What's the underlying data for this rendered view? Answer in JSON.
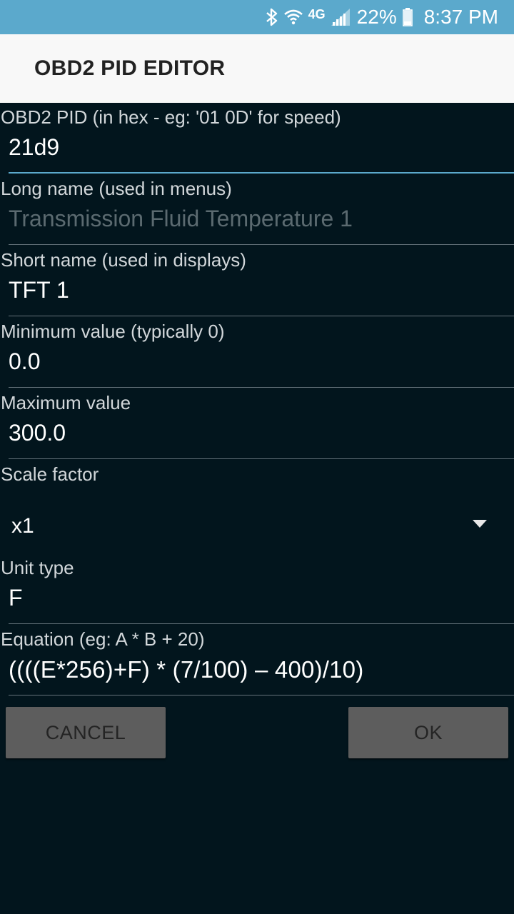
{
  "status_bar": {
    "icons": [
      "bluetooth-icon",
      "wifi-icon",
      "4g-lte-icon",
      "signal-icon",
      "battery-icon"
    ],
    "network_label": "4G",
    "battery_percent": "22%",
    "time": "8:37 PM"
  },
  "app_bar": {
    "title": "OBD2 PID EDITOR"
  },
  "form": {
    "pid": {
      "label": "OBD2 PID (in hex - eg: '01 0D' for speed)",
      "value": "21d9"
    },
    "long_name": {
      "label": "Long name (used in menus)",
      "placeholder": "Transmission Fluid Temperature 1"
    },
    "short_name": {
      "label": "Short name (used in displays)",
      "value": "TFT 1"
    },
    "min_value": {
      "label": "Minimum value (typically 0)",
      "value": "0.0"
    },
    "max_value": {
      "label": "Maximum value",
      "value": "300.0"
    },
    "scale_factor": {
      "label": "Scale factor",
      "selected": "x1"
    },
    "unit_type": {
      "label": "Unit type",
      "value": "F"
    },
    "equation": {
      "label": "Equation (eg:  A * B + 20)",
      "value": "((((E*256)+F) * (7/100) – 400)/10)"
    }
  },
  "buttons": {
    "cancel_label": "CANCEL",
    "ok_label": "OK"
  },
  "colors": {
    "status_bar_bg": "#5ba9cc",
    "app_bar_bg": "#f8f8f8",
    "background": "#02151d",
    "accent": "#5ba9cc",
    "button_bg": "#5d5d5d"
  }
}
